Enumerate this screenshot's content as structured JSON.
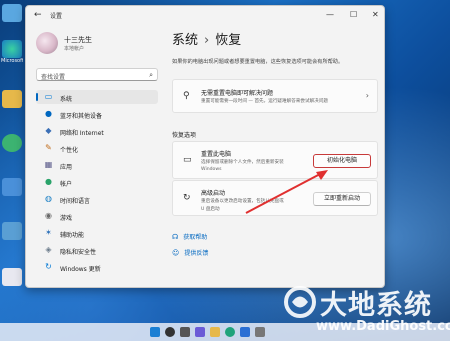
{
  "window": {
    "app_title": "设置",
    "back_glyph": "←",
    "minimize_glyph": "—",
    "maximize_glyph": "☐",
    "close_glyph": "✕"
  },
  "user": {
    "name": "十三先生",
    "type": "本地帐户"
  },
  "search": {
    "placeholder": "查找设置"
  },
  "sidebar": {
    "items": [
      {
        "label": "系统",
        "icon": "display-icon",
        "color": "#0078d4",
        "active": true
      },
      {
        "label": "蓝牙和其他设备",
        "icon": "bluetooth-icon",
        "color": "#0067c0"
      },
      {
        "label": "网络和 Internet",
        "icon": "network-icon",
        "color": "#3b6fb6"
      },
      {
        "label": "个性化",
        "icon": "brush-icon",
        "color": "#c06b1a"
      },
      {
        "label": "应用",
        "icon": "apps-icon",
        "color": "#5a5a8a"
      },
      {
        "label": "帐户",
        "icon": "account-icon",
        "color": "#2aa36a"
      },
      {
        "label": "时间和语言",
        "icon": "globe-clock-icon",
        "color": "#1a7fc4"
      },
      {
        "label": "游戏",
        "icon": "gamepad-icon",
        "color": "#6a6a6a"
      },
      {
        "label": "辅助功能",
        "icon": "accessibility-icon",
        "color": "#2a6fb8"
      },
      {
        "label": "隐私和安全性",
        "icon": "shield-icon",
        "color": "#6a7a8a"
      },
      {
        "label": "Windows 更新",
        "icon": "update-icon",
        "color": "#0078d4"
      }
    ]
  },
  "main": {
    "breadcrumb_parent": "系统",
    "breadcrumb_sep": "›",
    "breadcrumb_current": "恢复",
    "description": "如果你的电脑出现问题或者想要重置电脑，这些恢复选项可能会有所帮助。",
    "troubleshoot_card": {
      "title": "无需重置电脑即可解决问题",
      "subtitle": "重置可能需要一段时间 — 首先，运行疑难解答来尝试解决问题",
      "chevron": "›"
    },
    "section_title": "恢复选项",
    "reset_card": {
      "title": "重置此电脑",
      "subtitle_line1": "选择保留或删除个人文件，然后重新安装",
      "subtitle_line2": "Windows",
      "button_label": "初始化电脑"
    },
    "advanced_card": {
      "title": "高级启动",
      "subtitle_line1": "重启设备以更改启动设置，包括从光盘或",
      "subtitle_line2": "U 盘启动",
      "button_label": "立即重新启动"
    },
    "links": [
      {
        "label": "获取帮助",
        "icon": "help-icon"
      },
      {
        "label": "提供反馈",
        "icon": "feedback-icon"
      }
    ]
  },
  "desktop_icons": [
    {
      "label": "",
      "color": "#5aa7e0"
    },
    {
      "label": "Microsoft Edge",
      "color": "#1fa37b"
    },
    {
      "label": "",
      "color": "#e6b84a"
    },
    {
      "label": "",
      "color": "#3cb371"
    },
    {
      "label": "",
      "color": "#4a90d9"
    },
    {
      "label": "",
      "color": "#cfd8e3"
    },
    {
      "label": "",
      "color": "#5a9fd4"
    },
    {
      "label": "",
      "color": "#e8e8f0"
    }
  ],
  "watermark": {
    "main": "大地系统",
    "sub": "www.DadiGhost.com"
  },
  "colors": {
    "accent": "#0067c0",
    "highlight": "#d43a3a"
  }
}
